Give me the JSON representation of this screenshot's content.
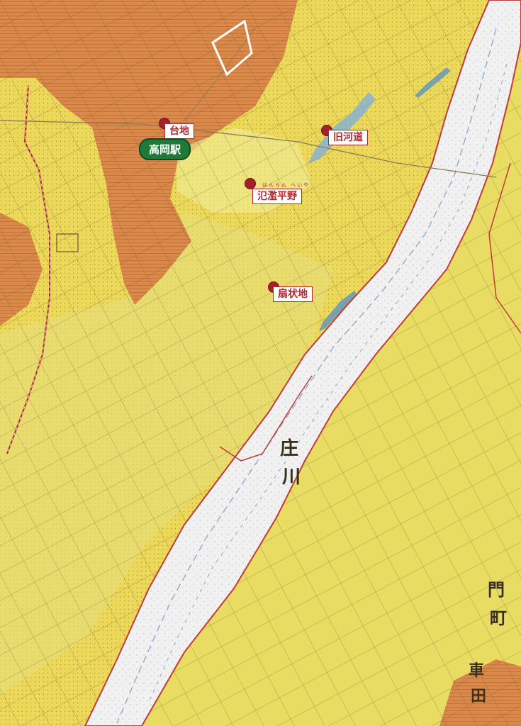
{
  "colors": {
    "plain_yellow": "#ecd85a",
    "fan_yellow": "#e3e27c",
    "terrace_orange": "#d98a4a",
    "river_white": "#f1f1f1",
    "marker_red": "#a3222a",
    "station_green": "#1f7a3a"
  },
  "labels": {
    "terrace": "台地",
    "station": "高岡駅",
    "old_channel": "旧河道",
    "floodplain": "氾濫平野",
    "floodplain_ruby": "はんらん へいや",
    "fan": "扇状地"
  },
  "map_text": {
    "river": "庄",
    "river2": "川",
    "right_bank_1": "門",
    "right_bank_2": "町",
    "right_bank_3": "車",
    "right_bank_4": "田"
  }
}
